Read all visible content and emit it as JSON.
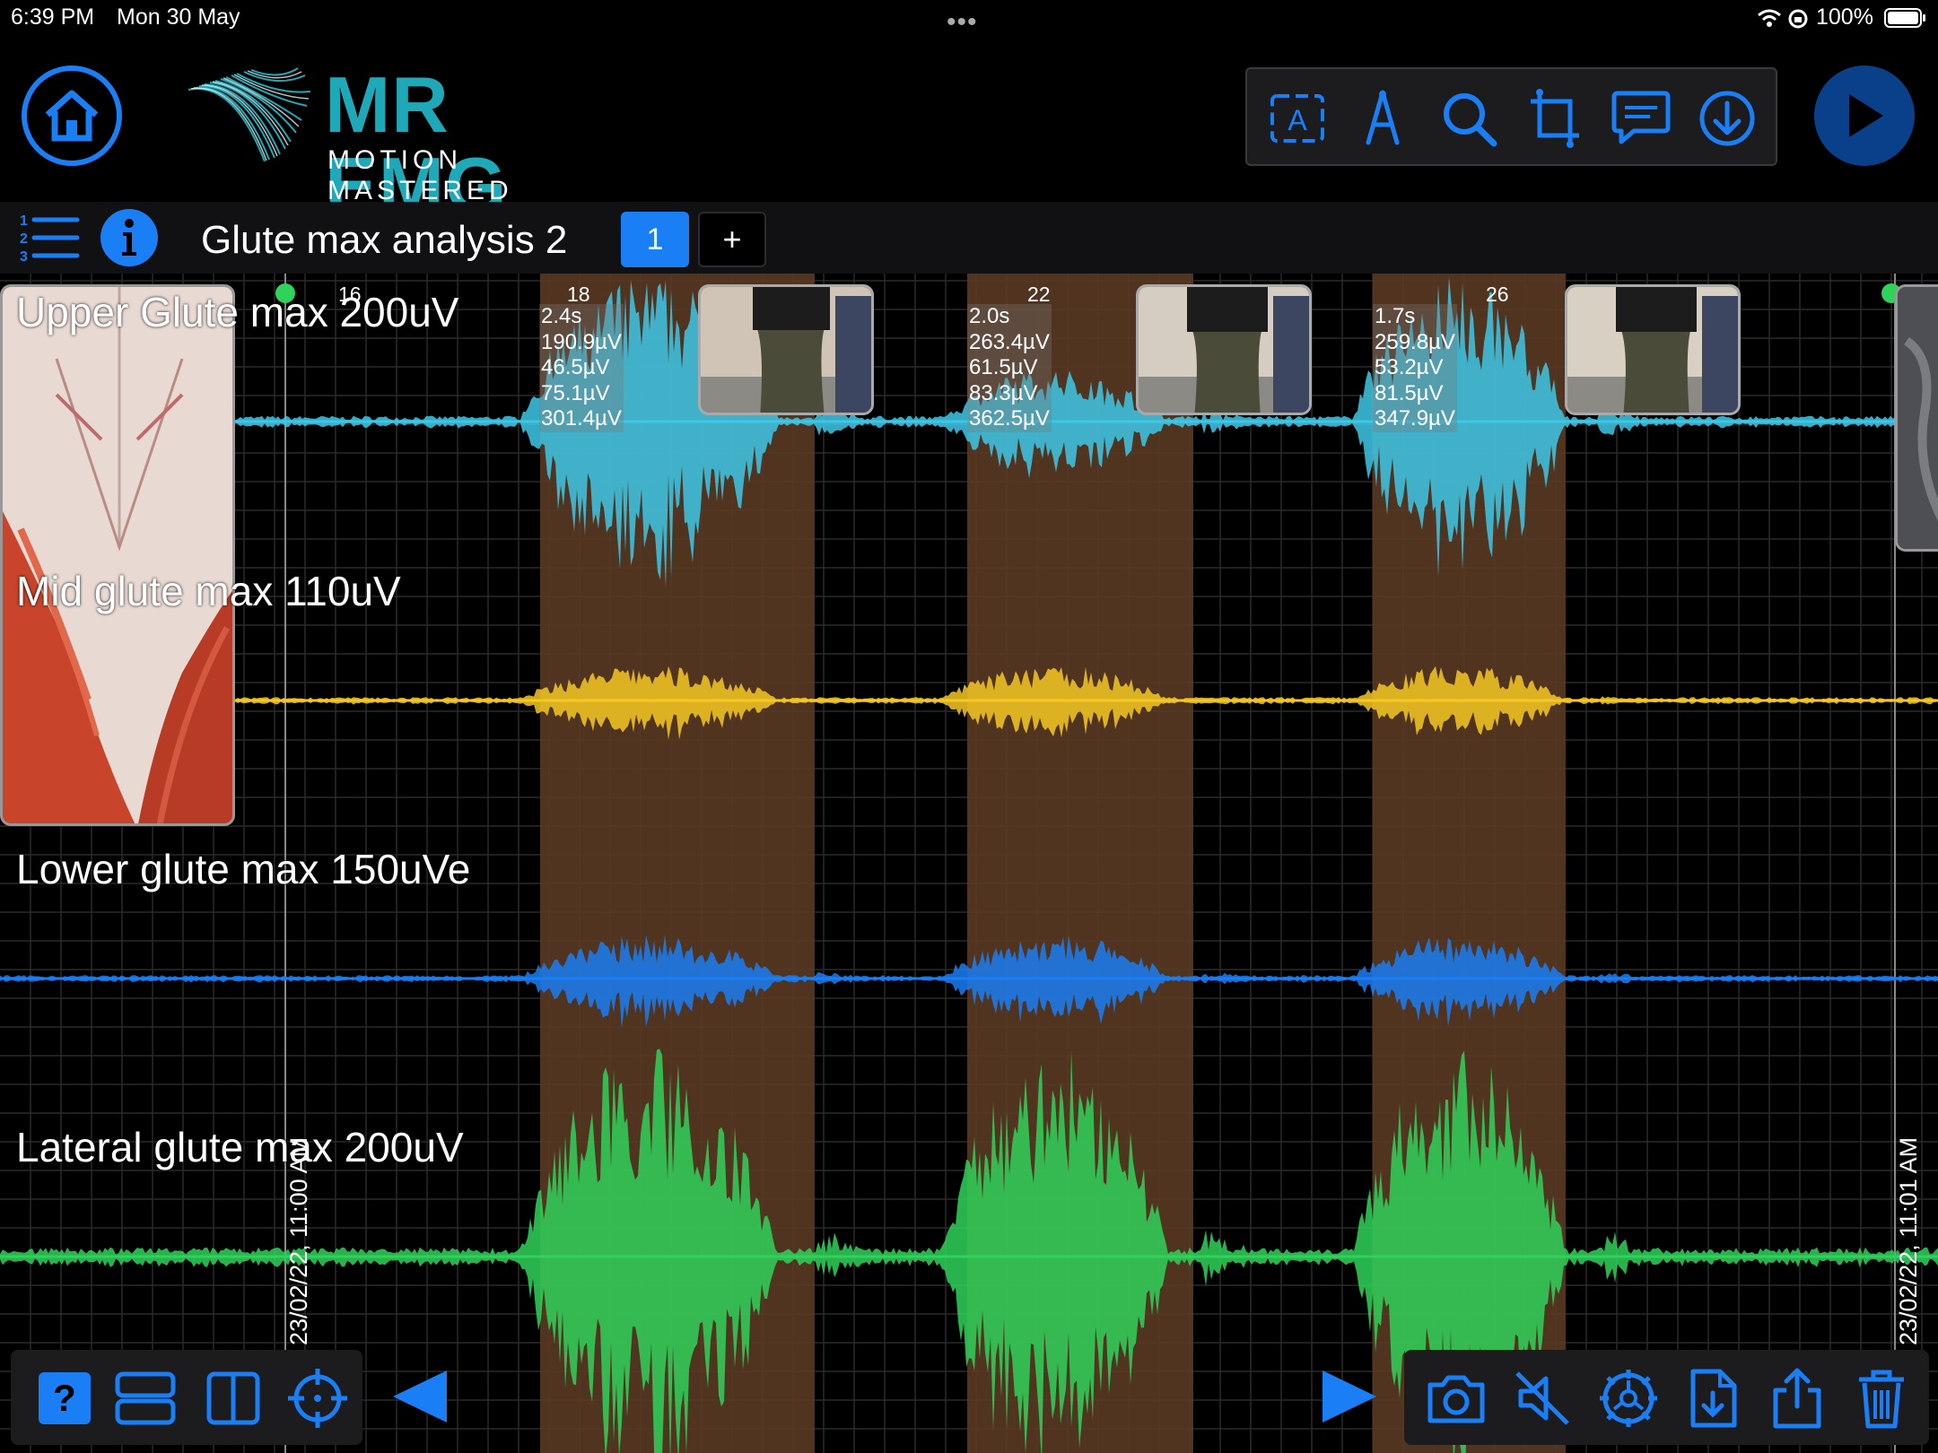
{
  "status_bar": {
    "time": "6:39 PM",
    "date": "Mon 30 May",
    "battery": "100%"
  },
  "brand": {
    "title": "MR EMG",
    "subtitle": "MOTION MASTERED"
  },
  "toolbar": {
    "icons": [
      "text-annotation-icon",
      "pen-icon",
      "magnifier-icon",
      "crop-icon",
      "comment-icon",
      "download-icon"
    ]
  },
  "analysis": {
    "title": "Glute max analysis 2",
    "page": "1",
    "add": "+"
  },
  "channels": [
    {
      "label": "Upper Glute max 200uV",
      "color": "#3ec8e8"
    },
    {
      "label": "Mid glute max 110uV",
      "color": "#f5c823"
    },
    {
      "label": "Lower glute max 150uVe",
      "color": "#1a7ef5"
    },
    {
      "label": "Lateral glute max 200uV",
      "color": "#2fd25a"
    }
  ],
  "marker_left": {
    "number": "16"
  },
  "reps": [
    {
      "number": "18",
      "stats": [
        "2.4s",
        "190.9µV",
        "46.5µV",
        "75.1µV",
        "301.4µV"
      ]
    },
    {
      "number": "22",
      "stats": [
        "2.0s",
        "263.4µV",
        "61.5µV",
        "83.3µV",
        "362.5µV"
      ]
    },
    {
      "number": "26",
      "stats": [
        "1.7s",
        "259.8µV",
        "53.2µV",
        "81.5µV",
        "347.9µV"
      ]
    }
  ],
  "timestamps": {
    "start": "23/02/22, 11:00 AM",
    "end": "23/02/22, 11:01 AM"
  },
  "bottom_left": {
    "help": "?",
    "icons": [
      "question-icon",
      "rows-layout-icon",
      "columns-layout-icon",
      "crosshair-icon"
    ]
  },
  "bottom_right": {
    "icons": [
      "camera-icon",
      "mute-icon",
      "settings-icon",
      "export-file-icon",
      "share-icon",
      "trash-icon"
    ]
  },
  "colors": {
    "accent": "#1a7ef5",
    "brand": "#1fa9b8",
    "highlight": "#5a3a22"
  }
}
